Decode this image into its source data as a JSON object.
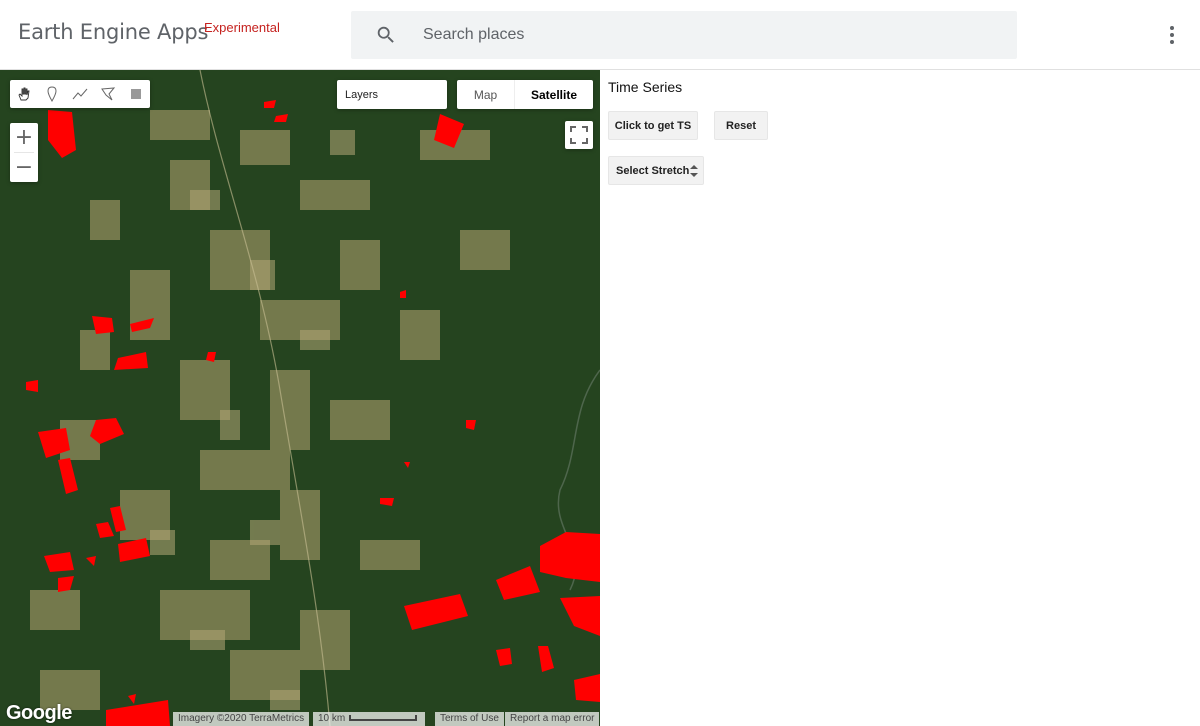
{
  "header": {
    "brand": "Earth Engine Apps",
    "brand_tag": "Experimental",
    "search": {
      "placeholder": "Search places",
      "value": ""
    },
    "icons": [
      "search-icon",
      "more-vert-icon"
    ]
  },
  "map": {
    "drawing_tools": [
      "pan-hand-icon",
      "point-marker-icon",
      "line-draw-icon",
      "polygon-draw-icon",
      "rectangle-draw-icon"
    ],
    "zoom_in": "+",
    "zoom_out": "−",
    "layers_label": "Layers",
    "map_type": {
      "map": "Map",
      "satellite": "Satellite",
      "selected": "Satellite"
    },
    "google_logo": "Google",
    "attribution": "Imagery ©2020 TerraMetrics",
    "scale": "10 km",
    "terms": "Terms of Use",
    "report": "Report a map error",
    "colors": {
      "forest": "#24421f",
      "cleared": "#a89a6a",
      "overlay": "#ff0000"
    }
  },
  "panel": {
    "title": "Time Series",
    "button_ts": "Click to get TS",
    "button_reset": "Reset",
    "select_stretch": "Select Stretch"
  }
}
